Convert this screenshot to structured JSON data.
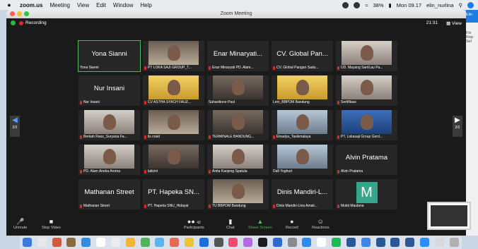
{
  "menubar": {
    "app": "zoom.us",
    "items": [
      "Meeting",
      "View",
      "Edit",
      "Window",
      "Help"
    ],
    "battery": "38%",
    "clock": "Mon 09.17",
    "user": "elin_nurlina"
  },
  "window": {
    "title": "Zoom Meeting",
    "recording_label": "Recording",
    "timer": "21:31",
    "view_label": "View"
  },
  "pager": {
    "left": "2/2",
    "right": "2/2"
  },
  "tiles": [
    {
      "big": "Yona Sianni",
      "label": "Yona Sianni",
      "muted": false,
      "video": false,
      "active": true
    },
    {
      "big": "",
      "label": "PT LOKA SAJI GROUP_T...",
      "muted": true,
      "video": true,
      "vclass": "c1"
    },
    {
      "big": "Enar Minaryati...",
      "label": "Enar Minaryati PD. Alam...",
      "muted": true,
      "video": false
    },
    {
      "big": "CV. Global Pan...",
      "label": "CV. Global Pangan Sadu...",
      "muted": true,
      "video": false
    },
    {
      "big": "",
      "label": "UD. Mayang Sari/Lau Pa...",
      "muted": true,
      "video": true,
      "vclass": "c4"
    },
    {
      "big": "Nur Insani",
      "label": "Nur Insani",
      "muted": true,
      "video": false
    },
    {
      "big": "",
      "label": "CV ASTHA SYACH FAUZ...",
      "muted": true,
      "video": true,
      "vclass": "c3"
    },
    {
      "big": "",
      "label": "Suhardiono Paul",
      "muted": false,
      "video": true,
      "vclass": "c6"
    },
    {
      "big": "",
      "label": "Leni_BBPOM Bandung",
      "muted": false,
      "video": true,
      "vclass": "c3"
    },
    {
      "big": "",
      "label": "Sertifikasi",
      "muted": true,
      "video": true,
      "vclass": "c4"
    },
    {
      "big": "",
      "label": "Berkah Raos_Suryana Fa...",
      "muted": true,
      "video": true,
      "vclass": "c4"
    },
    {
      "big": "",
      "label": "lis rosid",
      "muted": true,
      "video": true,
      "vclass": "c1"
    },
    {
      "big": "",
      "label": "TERMINALE BANDUNG...",
      "muted": true,
      "video": true,
      "vclass": "c6"
    },
    {
      "big": "",
      "label": "Elnadya_Tasikmalaya",
      "muted": true,
      "video": true,
      "vclass": "c2"
    },
    {
      "big": "",
      "label": "PT. Lokasaji Group Gord...",
      "muted": true,
      "video": true,
      "vclass": "c5"
    },
    {
      "big": "",
      "label": "PD. Alam Aneka Aroma",
      "muted": true,
      "video": true,
      "vclass": "c4"
    },
    {
      "big": "",
      "label": "lattcini",
      "muted": true,
      "video": true,
      "vclass": "c6"
    },
    {
      "big": "",
      "label": "Anita Kanjeng Spatula",
      "muted": true,
      "video": true,
      "vclass": "c4"
    },
    {
      "big": "",
      "label": "Dafi Yoghurt",
      "muted": false,
      "video": true,
      "vclass": "c2"
    },
    {
      "big": "Alvin Pratama",
      "label": "Alvin Pratama",
      "muted": true,
      "video": false
    },
    {
      "big": "Mathanan Street",
      "label": "Mathanan Street",
      "muted": true,
      "video": false
    },
    {
      "big": "PT. Hapeka SN...",
      "label": "PT. Hapeka SNU_Hidayat",
      "muted": true,
      "video": false
    },
    {
      "big": "",
      "label": "TU BBPOM Bandung",
      "muted": true,
      "video": true,
      "vclass": "c1"
    },
    {
      "big": "Dinis Mandiri-L...",
      "label": "Dinis Mandiri-Lina Amali...",
      "muted": true,
      "video": false
    },
    {
      "big": "",
      "label": "Mukti Maulana",
      "muted": true,
      "video": false,
      "avatar": "M"
    }
  ],
  "toolbar": {
    "unmute": "Unmute",
    "stop_video": "Stop Video",
    "participants": "Participants",
    "participants_count": "42",
    "chat": "Chat",
    "share_screen": "Share Screen",
    "record": "Record",
    "reactions": "Reactions"
  },
  "side_panel": {
    "items": [
      "Elin",
      "Fix",
      "Rep",
      "Sel"
    ]
  },
  "colors": {
    "accent_green": "#4cbb5c",
    "mute_red": "#e02828",
    "zoom_blue": "#1e7de0"
  }
}
